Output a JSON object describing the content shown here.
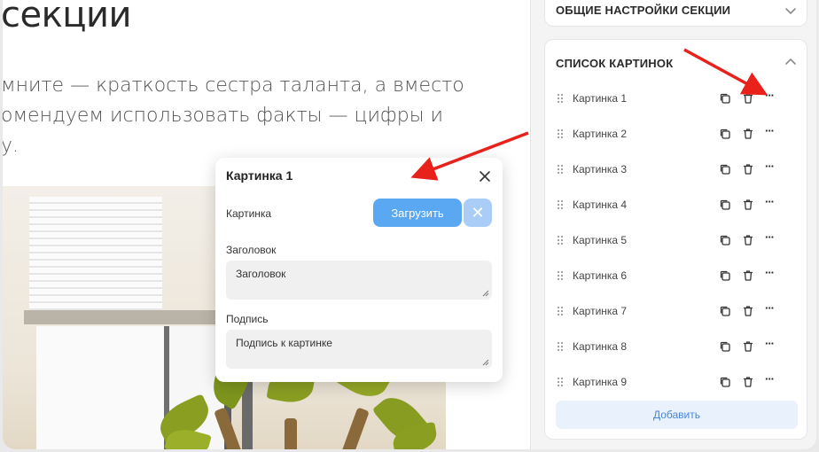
{
  "canvas": {
    "heading": "секции",
    "text_lines": [
      "мните — краткость сестра таланта, а вместо",
      "омендуем использовать факты — цифры и",
      "у."
    ]
  },
  "popup": {
    "title": "Картинка 1",
    "image_label": "Картинка",
    "upload_label": "Загрузить",
    "clear_symbol": "✕",
    "title_label": "Заголовок",
    "title_value": "Заголовок",
    "caption_label": "Подпись",
    "caption_value": "Подпись к картинке"
  },
  "panel": {
    "general_settings_title": "ОБЩИЕ НАСТРОЙКИ СЕКЦИИ",
    "image_list_title": "СПИСОК КАРТИНОК",
    "items": [
      {
        "label": "Картинка 1"
      },
      {
        "label": "Картинка 2"
      },
      {
        "label": "Картинка 3"
      },
      {
        "label": "Картинка 4"
      },
      {
        "label": "Картинка 5"
      },
      {
        "label": "Картинка 6"
      },
      {
        "label": "Картинка 7"
      },
      {
        "label": "Картинка 8"
      },
      {
        "label": "Картинка 9"
      }
    ],
    "add_label": "Добавить",
    "more_symbol": "···"
  },
  "icons": {
    "drag": "drag-handle-icon",
    "copy": "copy-icon",
    "delete": "trash-icon",
    "more": "more-icon",
    "close": "close-icon",
    "chevron_down": "chevron-down-icon",
    "chevron_up": "chevron-up-icon"
  },
  "colors": {
    "accent": "#5aa8f2",
    "accent_light": "#a9cdf6",
    "add_bg": "#e8f1fc",
    "add_text": "#4a86d8",
    "annotation_arrow": "#e8211b"
  }
}
